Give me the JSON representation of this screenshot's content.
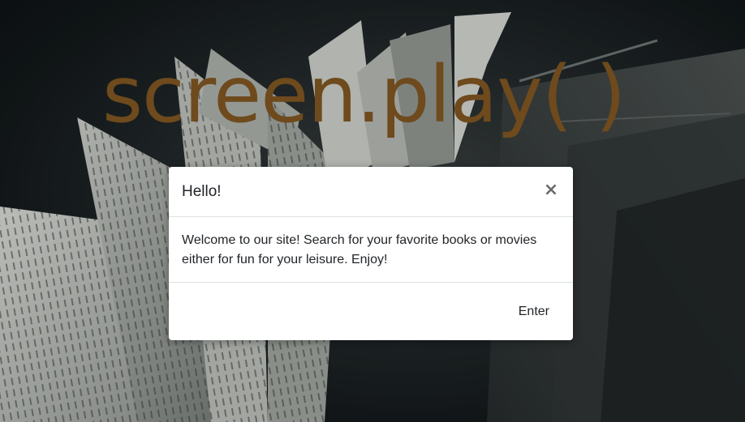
{
  "brand": {
    "title": "screen.play( )"
  },
  "modal": {
    "title": "Hello!",
    "close_glyph": "×",
    "body_text": "Welcome to our site! Search for your favorite books or movies either for fun for your leisure. Enjoy!",
    "enter_label": "Enter"
  },
  "colors": {
    "brand_text": "#6e4a1d",
    "background": "#1a1f21",
    "modal_bg": "#ffffff"
  },
  "icons": {
    "close": "close-icon"
  }
}
